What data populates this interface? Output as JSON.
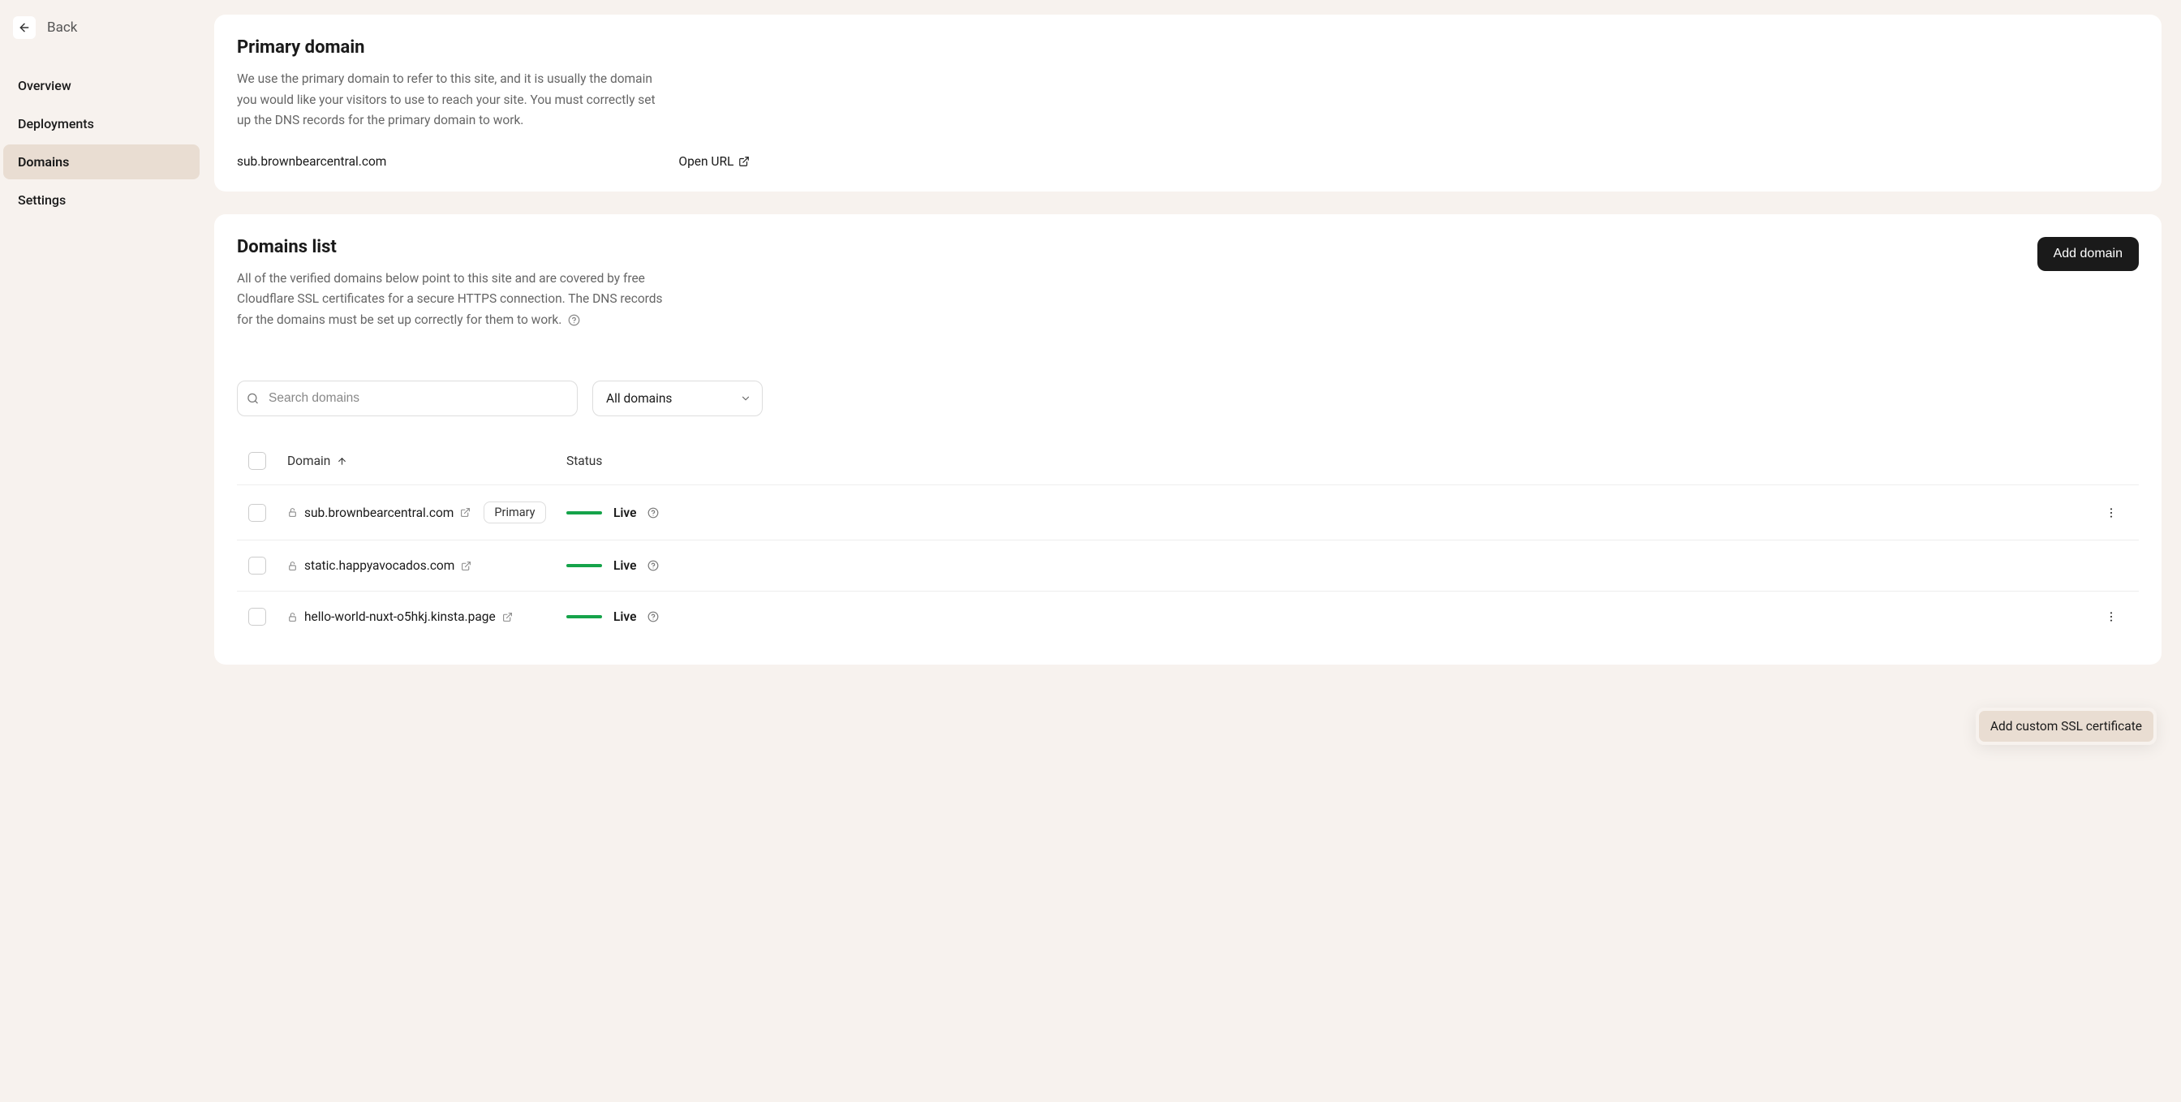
{
  "sidebar": {
    "back_label": "Back",
    "items": [
      {
        "label": "Overview"
      },
      {
        "label": "Deployments"
      },
      {
        "label": "Domains"
      },
      {
        "label": "Settings"
      }
    ],
    "active_index": 2
  },
  "primary_card": {
    "title": "Primary domain",
    "description": "We use the primary domain to refer to this site, and it is usually the domain you would like your visitors to use to reach your site. You must correctly set up the DNS records for the primary domain to work.",
    "domain": "sub.brownbearcentral.com",
    "open_url_label": "Open URL"
  },
  "domains_card": {
    "title": "Domains list",
    "description": "All of the verified domains below point to this site and are covered by free Cloudflare SSL certificates for a secure HTTPS connection. The DNS records for the domains must be set up correctly for them to work.",
    "add_button": "Add domain",
    "search_placeholder": "Search domains",
    "filter_label": "All domains",
    "headers": {
      "domain": "Domain",
      "status": "Status"
    },
    "primary_badge": "Primary",
    "status_live": "Live",
    "rows": [
      {
        "domain": "sub.brownbearcentral.com",
        "is_primary": true,
        "status": "Live",
        "show_menu": true
      },
      {
        "domain": "static.happyavocados.com",
        "is_primary": false,
        "status": "Live",
        "show_menu": false
      },
      {
        "domain": "hello-world-nuxt-o5hkj.kinsta.page",
        "is_primary": false,
        "status": "Live",
        "show_menu": true
      }
    ],
    "popover_item": "Add custom SSL certificate"
  }
}
